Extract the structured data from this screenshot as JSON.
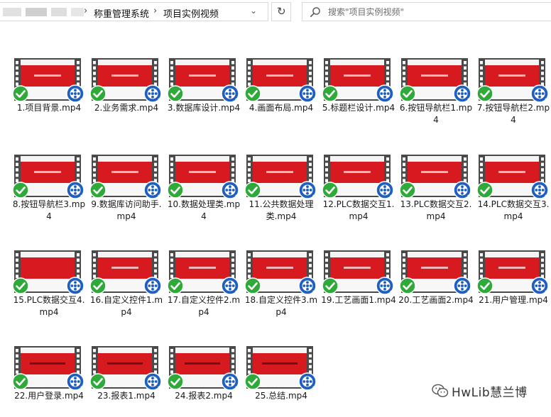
{
  "address_bar": {
    "breadcrumbs": [
      "称重管理系统",
      "项目实例视频"
    ],
    "dropdown_icon": "chevron-down-icon",
    "refresh_icon": "refresh-icon"
  },
  "search": {
    "placeholder": "搜索\"项目实例视频\"",
    "icon": "search-icon"
  },
  "files": [
    {
      "name": "1.项目背景.mp4",
      "title_style": "light"
    },
    {
      "name": "2.业务需求.mp4",
      "title_style": "light"
    },
    {
      "name": "3.数据库设计.mp4",
      "title_style": "light"
    },
    {
      "name": "4.画面布局.mp4",
      "title_style": "light"
    },
    {
      "name": "5.标题栏设计.mp4",
      "title_style": "light"
    },
    {
      "name": "6.按钮导航栏1.mp4",
      "title_style": "light"
    },
    {
      "name": "7.按钮导航栏2.mp4",
      "title_style": "light"
    },
    {
      "name": "8.按钮导航栏3.mp4",
      "title_style": "light"
    },
    {
      "name": "9.数据库访问助手.mp4",
      "title_style": "light"
    },
    {
      "name": "10.数据处理类.mp4",
      "title_style": "light"
    },
    {
      "name": "11.公共数据处理类.mp4",
      "title_style": "light"
    },
    {
      "name": "12.PLC数据交互1.mp4",
      "title_style": "light"
    },
    {
      "name": "13.PLC数据交互2.mp4",
      "title_style": "light"
    },
    {
      "name": "14.PLC数据交互3.mp4",
      "title_style": "light"
    },
    {
      "name": "15.PLC数据交互4.mp4",
      "title_style": "plain"
    },
    {
      "name": "16.自定义控件1.mp4",
      "title_style": "light"
    },
    {
      "name": "17.自定义控件2.mp4",
      "title_style": "light"
    },
    {
      "name": "18.自定义控件3.mp4",
      "title_style": "light"
    },
    {
      "name": "19.工艺画面1.mp4",
      "title_style": "light"
    },
    {
      "name": "20.工艺画面2.mp4",
      "title_style": "light"
    },
    {
      "name": "21.用户管理.mp4",
      "title_style": "light"
    },
    {
      "name": "22.用户登录.mp4",
      "title_style": "dark"
    },
    {
      "name": "23.报表1.mp4",
      "title_style": "dark"
    },
    {
      "name": "24.报表2.mp4",
      "title_style": "dark"
    },
    {
      "name": "25.总结.mp4",
      "title_style": "dark"
    }
  ],
  "watermark": {
    "text": "HwLib慧兰博",
    "icon": "wechat-icon"
  },
  "colors": {
    "thumbnail_red": "#d71920",
    "film_border": "#4a4a4a",
    "check_green": "#2faa3a",
    "media_blue": "#1f5fbf"
  }
}
